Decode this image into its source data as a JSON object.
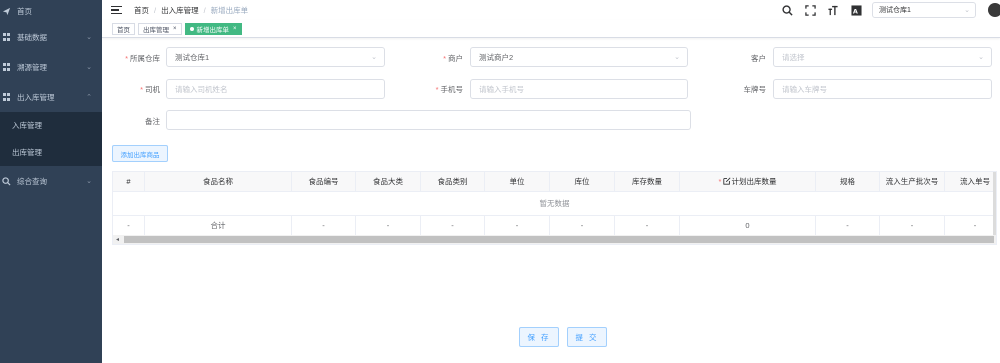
{
  "sidebar": {
    "items": [
      {
        "label": "首页",
        "icon": "send-icon"
      },
      {
        "label": "基础数据",
        "icon": "grid-icon"
      },
      {
        "label": "溯源管理",
        "icon": "grid-icon"
      },
      {
        "label": "出入库管理",
        "icon": "grid-icon"
      },
      {
        "label": "综合查询",
        "icon": "search-icon"
      }
    ],
    "submenu": [
      {
        "label": "入库管理"
      },
      {
        "label": "出库管理"
      }
    ]
  },
  "topbar": {
    "breadcrumb": [
      "首页",
      "出入库管理",
      "新增出库单"
    ],
    "warehouse_select": "测试仓库1"
  },
  "tags": [
    {
      "label": "首页"
    },
    {
      "label": "出库管理"
    },
    {
      "label": "新增出库单"
    }
  ],
  "form": {
    "warehouse": {
      "label": "所属仓库",
      "value": "测试仓库1"
    },
    "merchant": {
      "label": "商户",
      "value": "测试商户2"
    },
    "customer": {
      "label": "客户",
      "placeholder": "请选择"
    },
    "driver": {
      "label": "司机",
      "placeholder": "请输入司机姓名"
    },
    "phone": {
      "label": "手机号",
      "placeholder": "请输入手机号"
    },
    "plate": {
      "label": "车牌号",
      "placeholder": "请输入车牌号"
    },
    "remark": {
      "label": "备注"
    }
  },
  "add_button": "添加出库商品",
  "table": {
    "columns": [
      "#",
      "食品名称",
      "食品编号",
      "食品大类",
      "食品类别",
      "单位",
      "库位",
      "库存数量",
      "计划出库数量",
      "规格",
      "流入生产批次号",
      "流入单号"
    ],
    "empty_text": "暂无数据",
    "summary": [
      "-",
      "合计",
      "-",
      "-",
      "-",
      "-",
      "-",
      "-",
      "0",
      "-",
      "-",
      "-"
    ]
  },
  "buttons": {
    "save": "保 存",
    "submit": "提 交"
  }
}
